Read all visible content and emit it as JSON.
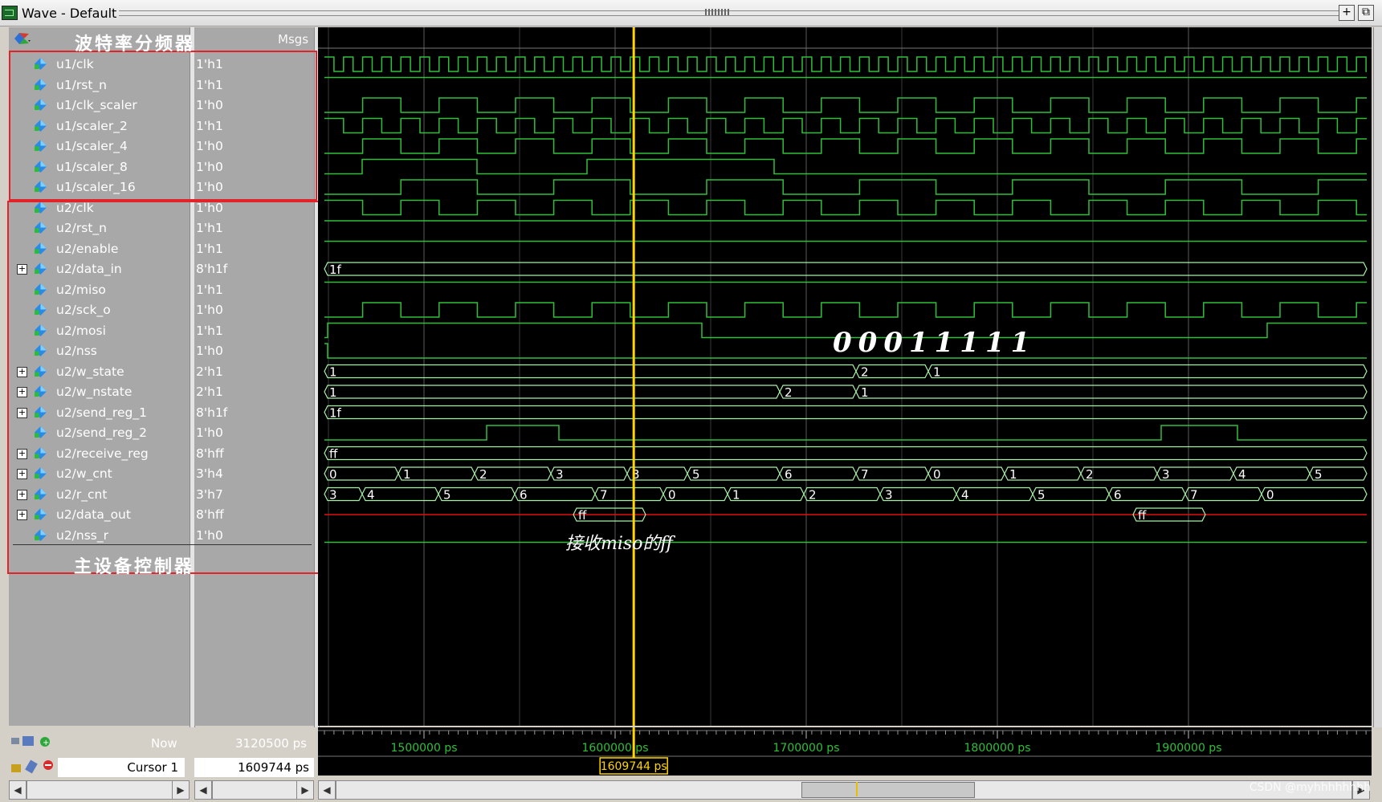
{
  "window": {
    "title": "Wave - Default"
  },
  "header": {
    "msgs_label": "Msgs"
  },
  "annotations": {
    "top_group": "波特率分频器",
    "bottom_group": "主设备控制器",
    "mosi_bits": "00011111",
    "receive_note": "接收miso的ff"
  },
  "signals": [
    {
      "name": "u1/clk",
      "value": "1'h1",
      "expandable": false
    },
    {
      "name": "u1/rst_n",
      "value": "1'h1",
      "expandable": false
    },
    {
      "name": "u1/clk_scaler",
      "value": "1'h0",
      "expandable": false
    },
    {
      "name": "u1/scaler_2",
      "value": "1'h1",
      "expandable": false
    },
    {
      "name": "u1/scaler_4",
      "value": "1'h0",
      "expandable": false
    },
    {
      "name": "u1/scaler_8",
      "value": "1'h0",
      "expandable": false
    },
    {
      "name": "u1/scaler_16",
      "value": "1'h0",
      "expandable": false
    },
    {
      "name": "u2/clk",
      "value": "1'h0",
      "expandable": false
    },
    {
      "name": "u2/rst_n",
      "value": "1'h1",
      "expandable": false
    },
    {
      "name": "u2/enable",
      "value": "1'h1",
      "expandable": false
    },
    {
      "name": "u2/data_in",
      "value": "8'h1f",
      "expandable": true
    },
    {
      "name": "u2/miso",
      "value": "1'h1",
      "expandable": false
    },
    {
      "name": "u2/sck_o",
      "value": "1'h0",
      "expandable": false
    },
    {
      "name": "u2/mosi",
      "value": "1'h1",
      "expandable": false
    },
    {
      "name": "u2/nss",
      "value": "1'h0",
      "expandable": false
    },
    {
      "name": "u2/w_state",
      "value": "2'h1",
      "expandable": true
    },
    {
      "name": "u2/w_nstate",
      "value": "2'h1",
      "expandable": true
    },
    {
      "name": "u2/send_reg_1",
      "value": "8'h1f",
      "expandable": true
    },
    {
      "name": "u2/send_reg_2",
      "value": "1'h0",
      "expandable": false
    },
    {
      "name": "u2/receive_reg",
      "value": "8'hff",
      "expandable": true
    },
    {
      "name": "u2/w_cnt",
      "value": "3'h4",
      "expandable": true
    },
    {
      "name": "u2/r_cnt",
      "value": "3'h7",
      "expandable": true
    },
    {
      "name": "u2/data_out",
      "value": "8'hff",
      "expandable": true
    },
    {
      "name": "u2/nss_r",
      "value": "1'h0",
      "expandable": false
    }
  ],
  "bus_labels": {
    "data_in": [
      "1f"
    ],
    "w_state": [
      "1",
      "2",
      "1"
    ],
    "w_nstate": [
      "1",
      "2",
      "1"
    ],
    "send_reg_1": [
      "1f"
    ],
    "receive_reg": [
      "ff"
    ],
    "w_cnt": [
      "0",
      "1",
      "2",
      "3",
      "3",
      "5",
      "6",
      "7",
      "0",
      "1",
      "2",
      "3",
      "4",
      "5"
    ],
    "r_cnt": [
      "3",
      "4",
      "5",
      "6",
      "7",
      "0",
      "1",
      "2",
      "3",
      "4",
      "5",
      "6",
      "7",
      "0"
    ],
    "data_out": [
      "ff",
      "ff"
    ]
  },
  "timeline": {
    "ticks": [
      "1500000 ps",
      "1600000 ps",
      "1700000 ps",
      "1800000 ps",
      "1900000 ps"
    ],
    "now_label": "Now",
    "now_value": "3120500 ps",
    "cursor_label": "Cursor 1",
    "cursor_value": "1609744 ps",
    "cursor_flag": "1609744 ps"
  },
  "colors": {
    "wave": "#2fbf3a",
    "cursor": "#ffd400",
    "bus": "#a8f0a8",
    "red_line": "#e01010"
  },
  "watermark": "CSDN @myhhhhhhhh"
}
